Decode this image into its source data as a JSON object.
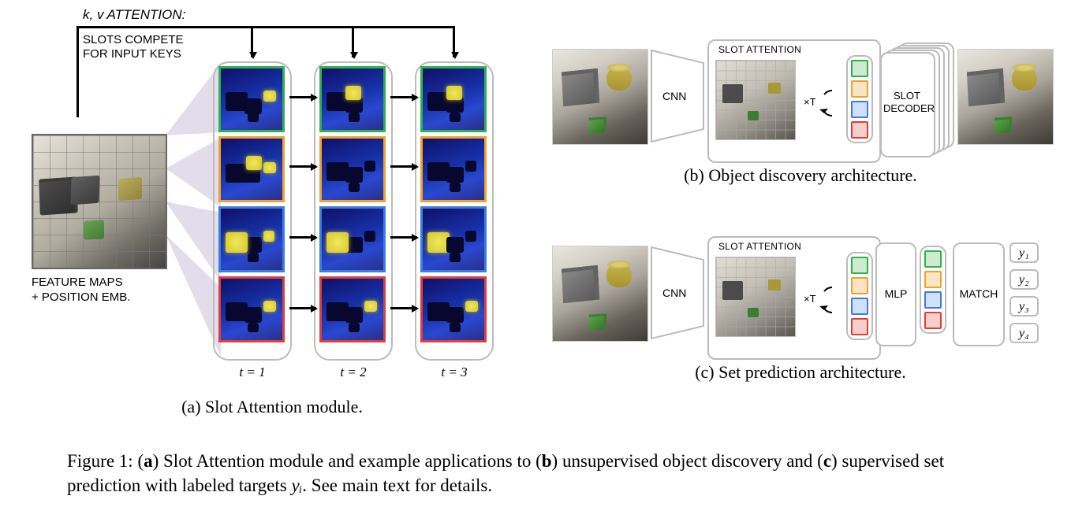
{
  "panelA": {
    "caption": "(a) Slot Attention module.",
    "kv_label": "k, v ATTENTION:",
    "compete_line1": "SLOTS COMPETE",
    "compete_line2": "FOR INPUT KEYS",
    "feature_label_line1": "FEATURE MAPS",
    "feature_label_line2": "+ POSITION EMB.",
    "t_labels": [
      "t = 1",
      "t = 2",
      "t = 3"
    ],
    "slot_colors": [
      "#2fb24c",
      "#f0a22e",
      "#3e7ddb",
      "#df3f3a"
    ]
  },
  "panelB": {
    "caption": "(b) Object discovery architecture.",
    "cnn_label": "CNN",
    "sa_label": "SLOT ATTENTION",
    "xt_label": "×T",
    "decoder_label_line1": "SLOT",
    "decoder_label_line2": "DECODER"
  },
  "panelC": {
    "caption": "(c) Set prediction architecture.",
    "cnn_label": "CNN",
    "sa_label": "SLOT ATTENTION",
    "xt_label": "×T",
    "mlp_label": "MLP",
    "match_label": "MATCH",
    "y_labels": [
      "y₁",
      "y₂",
      "y₃",
      "y₄"
    ]
  },
  "maincaption": {
    "prefix": "Figure 1: (",
    "a": "a",
    "mid1": ") Slot Attention module and example applications to (",
    "b": "b",
    "mid2": ") unsupervised object discovery and (",
    "c": "c",
    "mid3": ") supervised set prediction with labeled targets ",
    "yi": "yᵢ",
    "end": ". See main text for details."
  },
  "chart_data": {
    "type": "diagram",
    "note": "schematic figure, no numeric axes"
  }
}
